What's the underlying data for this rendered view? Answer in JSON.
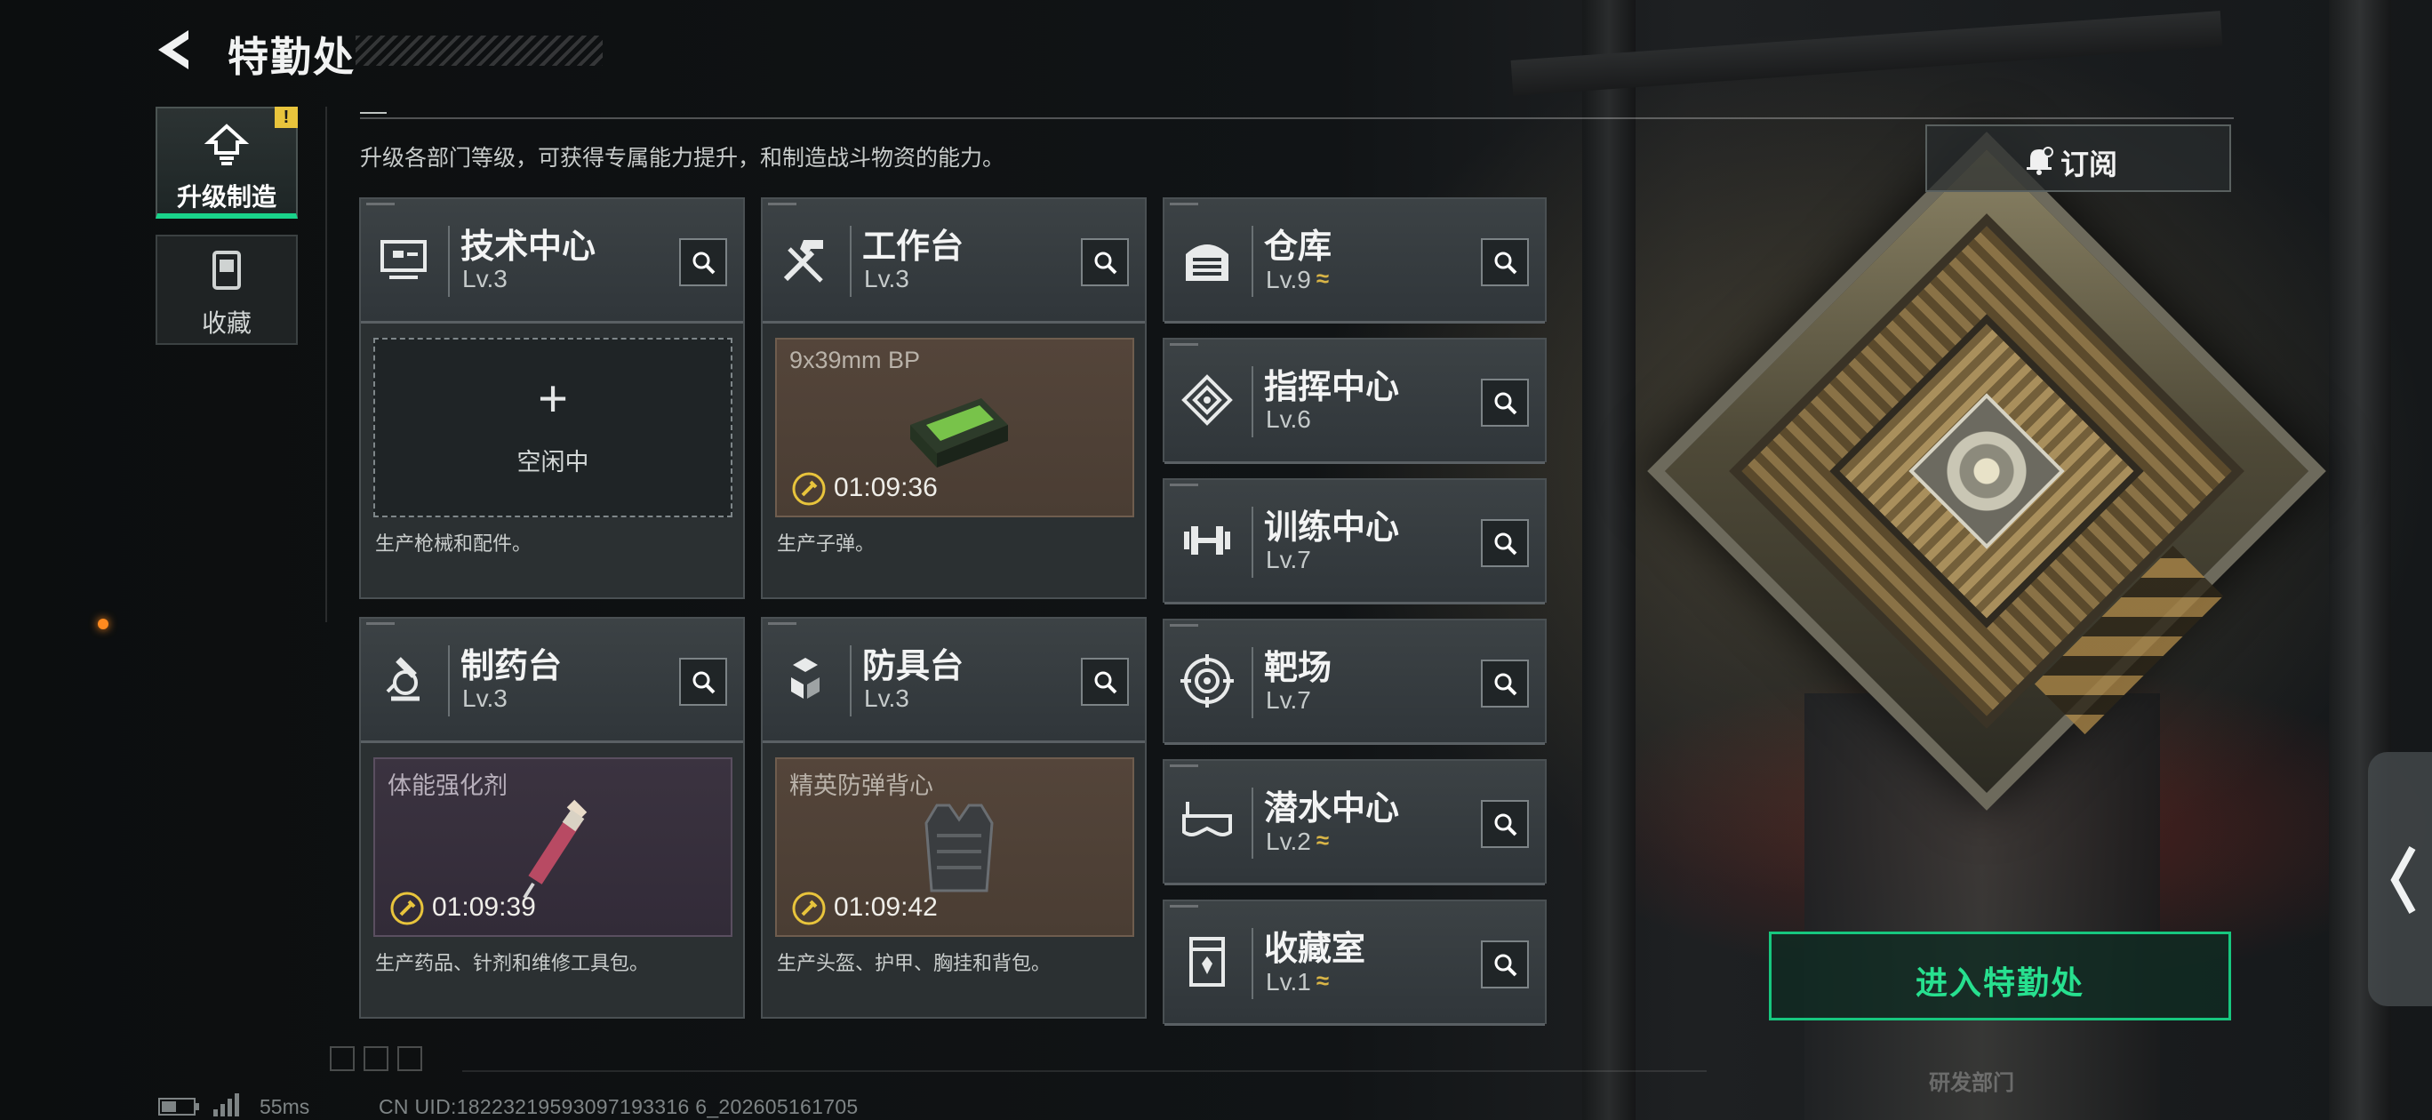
{
  "header": {
    "title": "特勤处"
  },
  "subtitle": "升级各部门等级，可获得专属能力提升，和制造战斗物资的能力。",
  "nav": {
    "tabs": [
      {
        "label": "升级制造",
        "badge": "!",
        "icon": "upgrade-icon",
        "active": true
      },
      {
        "label": "收藏",
        "icon": "collection-icon",
        "active": false
      }
    ]
  },
  "workbenches": [
    {
      "name": "技术中心",
      "level": "Lv.3",
      "icon": "tech-center-icon",
      "state": "idle",
      "idle_label": "空闲中",
      "plus": "+",
      "description": "生产枪械和配件。"
    },
    {
      "name": "工作台",
      "level": "Lv.3",
      "icon": "workbench-icon",
      "state": "producing",
      "item": "9x39mm BP",
      "timer": "01:09:36",
      "description": "生产子弹。"
    },
    {
      "name": "制药台",
      "level": "Lv.3",
      "icon": "pharmacy-icon",
      "state": "producing",
      "item": "体能强化剂",
      "timer": "01:09:39",
      "description": "生产药品、针剂和维修工具包。"
    },
    {
      "name": "防具台",
      "level": "Lv.3",
      "icon": "armor-bench-icon",
      "state": "producing",
      "item": "精英防弹背心",
      "timer": "01:09:42",
      "description": "生产头盔、护甲、胸挂和背包。"
    }
  ],
  "facilities": [
    {
      "name": "仓库",
      "level": "Lv.9",
      "upgradable": true,
      "icon": "warehouse-icon"
    },
    {
      "name": "指挥中心",
      "level": "Lv.6",
      "upgradable": false,
      "icon": "command-center-icon"
    },
    {
      "name": "训练中心",
      "level": "Lv.7",
      "upgradable": false,
      "icon": "training-center-icon"
    },
    {
      "name": "靶场",
      "level": "Lv.7",
      "upgradable": false,
      "icon": "shooting-range-icon"
    },
    {
      "name": "潜水中心",
      "level": "Lv.2",
      "upgradable": true,
      "icon": "diving-center-icon"
    },
    {
      "name": "收藏室",
      "level": "Lv.1",
      "upgradable": true,
      "icon": "collection-room-icon"
    }
  ],
  "upgrade_mark": "≈",
  "subscribe": {
    "label": "订阅",
    "icon": "bell-icon"
  },
  "enter_button": "进入特勤处",
  "status": {
    "ping": "55ms",
    "uid": "CN UID:18223219593097193316 6_202605161705"
  },
  "background_logo": "研发部门",
  "colors": {
    "accent": "#27e08f",
    "upgrade": "#d9b547",
    "badge": "#e8c43c"
  }
}
